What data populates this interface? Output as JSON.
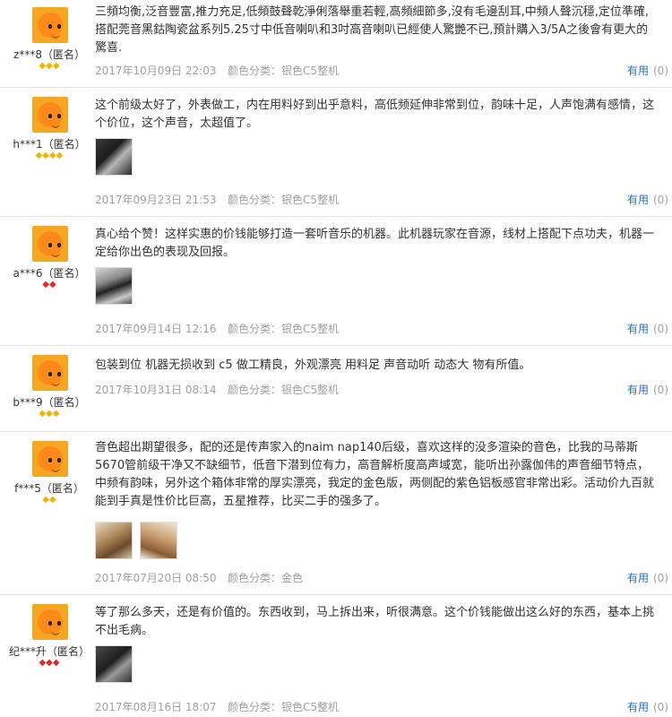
{
  "reviews": [
    {
      "user": "z***8（匿名）",
      "badges": "◆◆◆",
      "badge_color": "gold",
      "text": "三頻均衡,泛音豐富,推力充足,低頻鼓聲乾淨俐落舉重若輕,高頻細節多,沒有毛邊刮耳,中頻人聲沉穩,定位準確,搭配莞音黑鈷陶瓷盆系列5.25寸中低音喇叭和3吋高音喇叭已經使人驚艷不已,預計購入3/5A之後會有更大的驚喜.",
      "date": "2017年10月09日 22:03",
      "spec": "颜色分类：银色C5整机",
      "pics": []
    },
    {
      "user": "h***1（匿名）",
      "badges": "◆◆◆◆",
      "badge_color": "gold",
      "text": "这个前级太好了，外表做工，内在用料好到出乎意料，高低频延伸非常到位，韵味十足，人声饱满有感情，这个价位，这个声音，太超值了。",
      "date": "2017年09月23日 21:53",
      "spec": "颜色分类：银色C5整机",
      "pics": [
        "thumb-1"
      ]
    },
    {
      "user": "a***6（匿名）",
      "badges": "◆◆",
      "badge_color": "red",
      "text": "真心给个赞！这样实惠的价钱能够打造一套听音乐的机器。此机器玩家在音源，线材上搭配下点功夫，机器一定给你出色的表现及回报。",
      "date": "2017年09月14日 12:16",
      "spec": "颜色分类：银色C5整机",
      "pics": [
        "thumb-2"
      ]
    },
    {
      "user": "b***9（匿名）",
      "badges": "◆◆◆",
      "badge_color": "gold",
      "text": "包装到位 机器无损收到 c5 做工精良，外观漂亮 用料足 声音动听 动态大 物有所值。",
      "date": "2017年10月31日 08:14",
      "spec": "颜色分类：银色C5整机",
      "pics": []
    },
    {
      "user": "f***5（匿名）",
      "badges": "◆◆",
      "badge_color": "gold",
      "text": "音色超出期望很多，配的还是传声家入的naim nap140后级，喜欢这样的没多渲染的音色，比我的马蒂斯5670管前级干净又不缺细节，低音下潜到位有力，高音解析度高声域宽，能听出孙露伽伟的声音细节特点，中频有韵味，另外这个箱体非常的厚实漂亮，我定的金色版，两侧配的紫色铝板感官非常出彩。活动价九百就能到手真是性价比巨高，五星推荐，比买二手的强多了。",
      "date": "2017年07月20日 08:50",
      "spec": "颜色分类：金色",
      "pics": [
        "thumb-3",
        "thumb-4"
      ]
    },
    {
      "user": "纪***升（匿名）",
      "badges": "◆◆◆",
      "badge_color": "red",
      "text": "等了那么多天，还是有价值的。东西收到，马上拆出来，听很满意。这个价钱能做出这么好的东西，基本上挑不出毛病。",
      "date": "2017年08月16日 18:07",
      "spec": "颜色分类：银色C5整机",
      "pics": [
        "thumb-5"
      ]
    }
  ],
  "useful_label": "有用",
  "useful_count": "(0)",
  "colors": {
    "useful_link": "#2a6ebb",
    "meta_text": "#a0a0a0",
    "badge_gold": "#f0b400",
    "badge_red": "#e02a2a",
    "avatar_bg": "#f5a623"
  }
}
